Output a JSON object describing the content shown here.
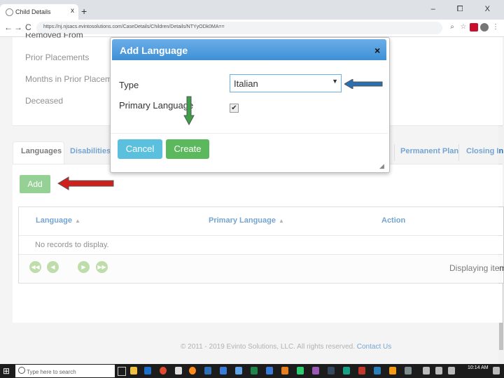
{
  "browser": {
    "tab_title": "Child Details",
    "tab_close": "x",
    "new_tab": "+",
    "window_controls": "– ⧠ X",
    "back": "←",
    "forward": "→",
    "reload": "C",
    "url": "https://nj.njsacs.evintosolutions.com/CaseDetails/Children/Details/NTYyODk0MA=="
  },
  "details": {
    "items": [
      {
        "label": "Removed From"
      },
      {
        "label": "Prior Placements"
      },
      {
        "label": "Months in Prior Placements"
      },
      {
        "label": "Deceased"
      }
    ]
  },
  "tabs": {
    "items": [
      {
        "label": "Languages"
      },
      {
        "label": "Disabilities"
      },
      {
        "label": "Permanent Plan"
      },
      {
        "label": "Closing In"
      }
    ]
  },
  "toolbar": {
    "add_label": "Add"
  },
  "grid": {
    "columns": [
      {
        "label": "Language"
      },
      {
        "label": "Primary Language"
      },
      {
        "label": "Action"
      }
    ],
    "sort_indicator": "▲",
    "empty_message": "No records to display.",
    "pager_info": "Displaying items"
  },
  "footer": {
    "text": "© 2011 - 2019 Evinto Solutions, LLC. All rights reserved.",
    "link": "Contact Us"
  },
  "modal": {
    "title": "Add Language",
    "close": "×",
    "type_label": "Type",
    "type_value": "Italian",
    "primary_label": "Primary Language",
    "primary_checked": "✔",
    "cancel_label": "Cancel",
    "create_label": "Create"
  },
  "taskbar": {
    "search_placeholder": "Type here to search",
    "clock": "10:14 AM"
  },
  "colors": {
    "accent": "#2a73b8",
    "modal_header": "#3f8fd6",
    "add_green": "#5cb85c",
    "cancel_blue": "#5bc0de",
    "arrow_blue": "#2a6fb0",
    "arrow_green": "#3da048",
    "arrow_red": "#d0201c"
  }
}
